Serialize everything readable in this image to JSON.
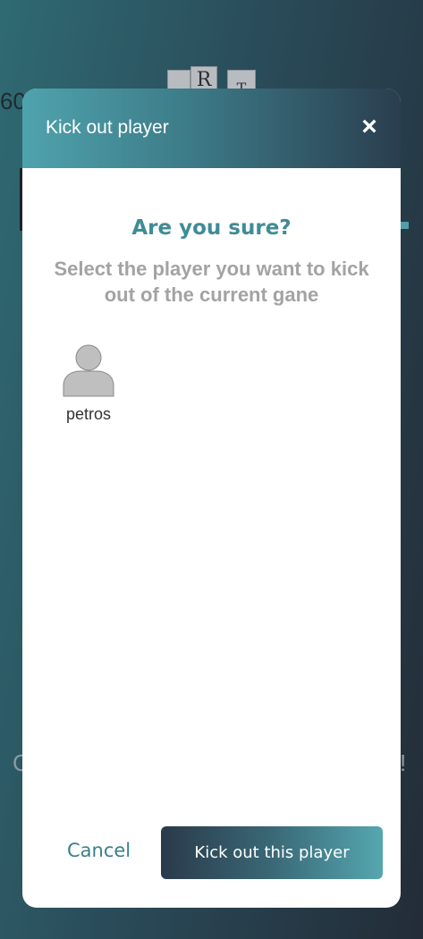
{
  "background": {
    "timer": "60",
    "tiles": [
      "",
      "R",
      "T"
    ],
    "text_left": "C",
    "text_right": "!"
  },
  "modal": {
    "title": "Kick out player",
    "close_icon": "×",
    "heading": "Are you sure?",
    "subtext": "Select the player you want to kick out of the current gane",
    "players": [
      {
        "name": "petros",
        "icon": "user-avatar-icon"
      }
    ],
    "cancel_label": "Cancel",
    "confirm_label": "Kick out this player"
  },
  "colors": {
    "accent": "#3f8c96",
    "header_gradient_start": "#4fa3ad",
    "header_gradient_end": "#2a3e4e",
    "muted_text": "#a3a3a3"
  }
}
